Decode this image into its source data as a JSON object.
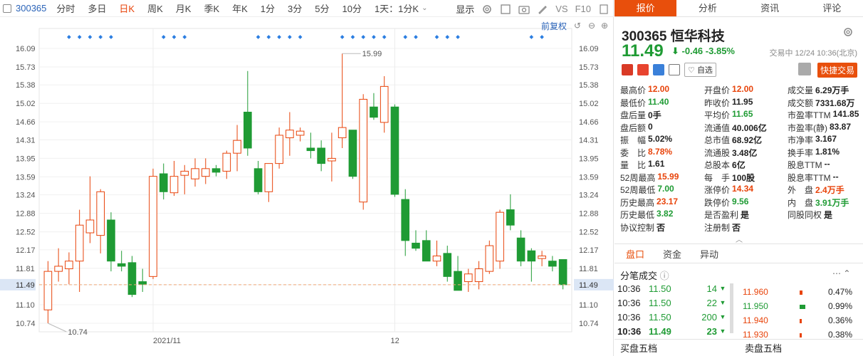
{
  "toolbar": {
    "code": "300365",
    "periods": [
      "分时",
      "多日",
      "日K",
      "周K",
      "月K",
      "季K",
      "年K",
      "1分",
      "3分",
      "5分",
      "10分",
      "1天：1分K"
    ],
    "active_period": "日K",
    "display_label": "显示",
    "vs_label": "VS",
    "f10_label": "F10"
  },
  "chart": {
    "fq_label": "前复权",
    "max_label": "15.99",
    "min_label": "10.74",
    "current_price_label": "11.49",
    "x_labels": [
      "2021/11",
      "12"
    ]
  },
  "chart_data": {
    "type": "candlestick",
    "y_ticks": [
      "16.09",
      "15.73",
      "15.38",
      "15.02",
      "14.66",
      "14.31",
      "13.95",
      "13.59",
      "13.24",
      "12.88",
      "12.52",
      "12.17",
      "11.81",
      "11.49",
      "11.10",
      "10.74"
    ],
    "ylim": [
      10.74,
      16.09
    ],
    "x_tick_labels": [
      "2021/11",
      "12"
    ],
    "annotations": {
      "high": 15.99,
      "low": 10.74,
      "last": 11.49
    },
    "candles": [
      {
        "o": 11.0,
        "h": 11.95,
        "l": 10.74,
        "c": 11.75
      },
      {
        "o": 11.75,
        "h": 12.2,
        "l": 11.55,
        "c": 11.85
      },
      {
        "o": 11.8,
        "h": 12.12,
        "l": 11.5,
        "c": 11.95
      },
      {
        "o": 11.95,
        "h": 12.95,
        "l": 11.35,
        "c": 12.65
      },
      {
        "o": 12.5,
        "h": 13.6,
        "l": 12.3,
        "c": 12.75
      },
      {
        "o": 12.45,
        "h": 13.35,
        "l": 12.1,
        "c": 13.3
      },
      {
        "o": 12.75,
        "h": 12.9,
        "l": 11.75,
        "c": 11.95
      },
      {
        "o": 11.9,
        "h": 12.15,
        "l": 11.75,
        "c": 11.85
      },
      {
        "o": 11.92,
        "h": 12.05,
        "l": 11.25,
        "c": 11.3
      },
      {
        "o": 11.55,
        "h": 11.8,
        "l": 11.35,
        "c": 11.5
      },
      {
        "o": 11.65,
        "h": 13.75,
        "l": 11.6,
        "c": 13.6
      },
      {
        "o": 13.65,
        "h": 13.85,
        "l": 13.15,
        "c": 13.3
      },
      {
        "o": 13.28,
        "h": 13.9,
        "l": 13.22,
        "c": 13.6
      },
      {
        "o": 13.62,
        "h": 13.82,
        "l": 13.25,
        "c": 13.7
      },
      {
        "o": 13.55,
        "h": 13.95,
        "l": 13.4,
        "c": 13.75
      },
      {
        "o": 13.6,
        "h": 13.95,
        "l": 13.45,
        "c": 13.75
      },
      {
        "o": 13.75,
        "h": 13.82,
        "l": 13.6,
        "c": 13.68
      },
      {
        "o": 13.7,
        "h": 14.1,
        "l": 13.55,
        "c": 14.05
      },
      {
        "o": 14.05,
        "h": 14.6,
        "l": 13.7,
        "c": 14.3
      },
      {
        "o": 14.85,
        "h": 15.65,
        "l": 14.0,
        "c": 14.15
      },
      {
        "o": 13.75,
        "h": 13.9,
        "l": 13.25,
        "c": 13.3
      },
      {
        "o": 13.3,
        "h": 13.82,
        "l": 13.1,
        "c": 13.85
      },
      {
        "o": 13.85,
        "h": 14.55,
        "l": 13.75,
        "c": 14.4
      },
      {
        "o": 14.35,
        "h": 14.85,
        "l": 14.0,
        "c": 14.5
      },
      {
        "o": 14.4,
        "h": 14.55,
        "l": 14.28,
        "c": 14.48
      },
      {
        "o": 14.15,
        "h": 14.45,
        "l": 13.95,
        "c": 14.1
      },
      {
        "o": 14.15,
        "h": 14.3,
        "l": 13.7,
        "c": 13.85
      },
      {
        "o": 13.9,
        "h": 14.45,
        "l": 13.5,
        "c": 13.95
      },
      {
        "o": 14.35,
        "h": 15.99,
        "l": 14.15,
        "c": 14.55
      },
      {
        "o": 14.5,
        "h": 14.5,
        "l": 13.55,
        "c": 13.6
      },
      {
        "o": 13.1,
        "h": 15.2,
        "l": 12.95,
        "c": 15.1
      },
      {
        "o": 14.95,
        "h": 15.22,
        "l": 14.7,
        "c": 14.75
      },
      {
        "o": 14.65,
        "h": 15.55,
        "l": 14.45,
        "c": 15.35
      },
      {
        "o": 14.95,
        "h": 15.0,
        "l": 13.2,
        "c": 13.25
      },
      {
        "o": 13.15,
        "h": 13.35,
        "l": 12.05,
        "c": 12.35
      },
      {
        "o": 12.3,
        "h": 12.55,
        "l": 12.15,
        "c": 12.2
      },
      {
        "o": 12.35,
        "h": 12.55,
        "l": 11.95,
        "c": 11.95
      },
      {
        "o": 11.95,
        "h": 12.35,
        "l": 11.85,
        "c": 12.05
      },
      {
        "o": 12.1,
        "h": 12.25,
        "l": 11.55,
        "c": 11.65
      },
      {
        "o": 11.75,
        "h": 12.05,
        "l": 11.38,
        "c": 11.38
      },
      {
        "o": 11.55,
        "h": 11.8,
        "l": 11.35,
        "c": 11.7
      },
      {
        "o": 11.55,
        "h": 11.95,
        "l": 11.4,
        "c": 11.8
      },
      {
        "o": 11.75,
        "h": 12.35,
        "l": 11.7,
        "c": 12.25
      },
      {
        "o": 11.95,
        "h": 12.95,
        "l": 11.8,
        "c": 12.9
      },
      {
        "o": 12.95,
        "h": 13.25,
        "l": 12.55,
        "c": 12.65
      },
      {
        "o": 12.4,
        "h": 12.55,
        "l": 11.85,
        "c": 11.95
      },
      {
        "o": 12.15,
        "h": 12.2,
        "l": 11.55,
        "c": 11.95
      },
      {
        "o": 12.0,
        "h": 12.15,
        "l": 11.85,
        "c": 12.05
      },
      {
        "o": 11.95,
        "h": 12.05,
        "l": 11.75,
        "c": 11.85
      },
      {
        "o": 11.98,
        "h": 11.98,
        "l": 11.4,
        "c": 11.49
      }
    ],
    "colors": {
      "up": "#e8440b",
      "down": "#1f9b34"
    }
  },
  "tabs": [
    "报价",
    "分析",
    "资讯",
    "评论"
  ],
  "active_tab": "报价",
  "quote": {
    "code": "300365",
    "name": "恒华科技",
    "price": "11.49",
    "change": "-0.46",
    "pct": "-3.85%",
    "trade_time": "交易中 12/24 10:36(北京)",
    "zixuan_label": "自选",
    "kuaijie_label": "快捷交易"
  },
  "stats": [
    [
      [
        "最高价",
        "12.00",
        "red"
      ],
      [
        "开盘价",
        "12.00",
        "red"
      ],
      [
        "成交量",
        "6.29万手",
        ""
      ]
    ],
    [
      [
        "最低价",
        "11.40",
        "green"
      ],
      [
        "昨收价",
        "11.95",
        ""
      ],
      [
        "成交额",
        "7331.68万",
        ""
      ]
    ],
    [
      [
        "盘后量",
        "0手",
        ""
      ],
      [
        "平均价",
        "11.65",
        "green"
      ],
      [
        "市盈率TTM",
        "141.85",
        ""
      ]
    ],
    [
      [
        "盘后额",
        "0",
        ""
      ],
      [
        "流通值",
        "40.006亿",
        ""
      ],
      [
        "市盈率(静)",
        "83.87",
        ""
      ]
    ],
    [
      [
        "振　幅",
        "5.02%",
        ""
      ],
      [
        "总市值",
        "68.92亿",
        ""
      ],
      [
        "市净率",
        "3.167",
        ""
      ]
    ],
    [
      [
        "委　比",
        "8.78%",
        "red"
      ],
      [
        "流通股",
        "3.48亿",
        ""
      ],
      [
        "换手率",
        "1.81%",
        ""
      ]
    ],
    [
      [
        "量　比",
        "1.61",
        ""
      ],
      [
        "总股本",
        "6亿",
        ""
      ],
      [
        "股息TTM",
        "--",
        ""
      ]
    ],
    [
      [
        "52周最高",
        "15.99",
        "red"
      ],
      [
        "每　手",
        "100股",
        ""
      ],
      [
        "股息率TTM",
        "--",
        ""
      ]
    ],
    [
      [
        "52周最低",
        "7.00",
        "green"
      ],
      [
        "涨停价",
        "14.34",
        "red"
      ],
      [
        "外　盘",
        "2.4万手",
        "red"
      ]
    ],
    [
      [
        "历史最高",
        "23.17",
        "red"
      ],
      [
        "跌停价",
        "9.56",
        "green"
      ],
      [
        "内　盘",
        "3.91万手",
        "green"
      ]
    ],
    [
      [
        "历史最低",
        "3.82",
        "green"
      ],
      [
        "是否盈利",
        "是",
        ""
      ],
      [
        "同股同权",
        "是",
        ""
      ]
    ],
    [
      [
        "协议控制",
        "否",
        ""
      ],
      [
        "注册制",
        "否",
        ""
      ],
      [
        "",
        "",
        ""
      ]
    ]
  ],
  "subtabs": [
    "盘口",
    "资金",
    "异动"
  ],
  "active_subtab": "盘口",
  "fenbi_label": "分笔成交",
  "trades": [
    {
      "time": "10:36",
      "price": "11.50",
      "vol": "14"
    },
    {
      "time": "10:36",
      "price": "11.50",
      "vol": "22"
    },
    {
      "time": "10:36",
      "price": "11.50",
      "vol": "200"
    },
    {
      "time": "10:36",
      "price": "11.49",
      "vol": "23"
    }
  ],
  "levels": [
    {
      "price": "11.960",
      "pct": "0.47%",
      "color": "#e8440b"
    },
    {
      "price": "11.950",
      "pct": "0.99%",
      "color": "#1f9b34"
    },
    {
      "price": "11.940",
      "pct": "0.36%",
      "color": "#e8440b"
    },
    {
      "price": "11.930",
      "pct": "0.38%",
      "color": "#e8440b"
    }
  ],
  "bottom": {
    "buy5": "买盘五档",
    "sell5": "卖盘五档"
  }
}
